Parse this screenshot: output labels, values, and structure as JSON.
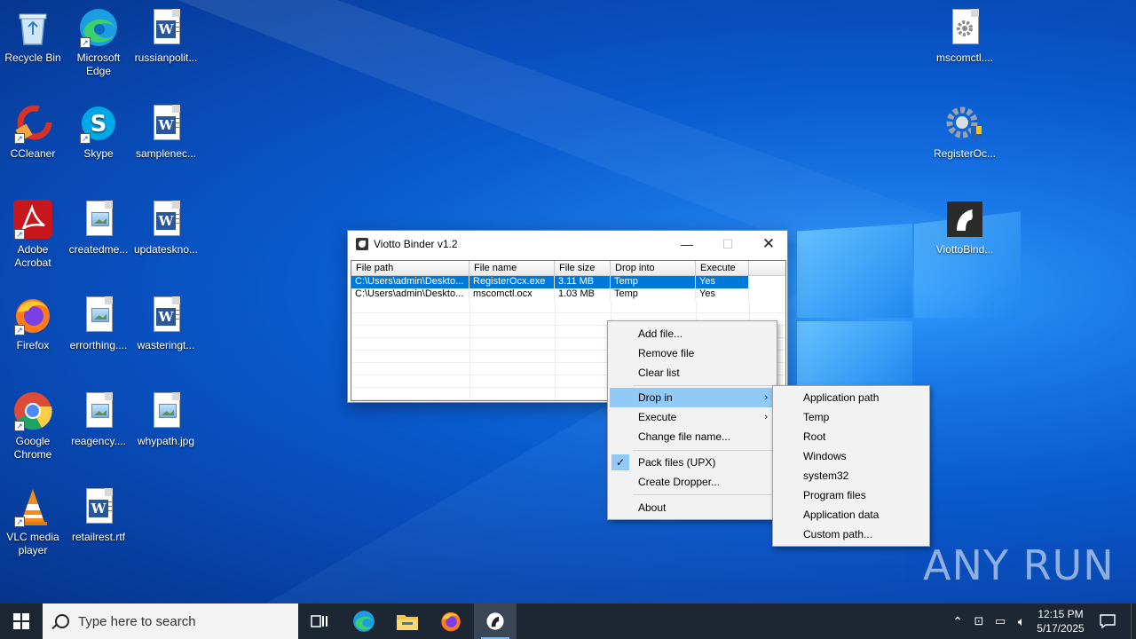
{
  "desktop": {
    "icons_col1": [
      {
        "label": "Recycle Bin"
      },
      {
        "label": "CCleaner"
      },
      {
        "label": "Adobe Acrobat"
      },
      {
        "label": "Firefox"
      },
      {
        "label": "Google Chrome"
      },
      {
        "label": "VLC media player"
      }
    ],
    "icons_col2": [
      {
        "label": "Microsoft Edge"
      },
      {
        "label": "Skype"
      },
      {
        "label": "createdme..."
      },
      {
        "label": "errorthing...."
      },
      {
        "label": "reagency...."
      },
      {
        "label": "retailrest.rtf"
      }
    ],
    "icons_col3": [
      {
        "label": "russianpolit..."
      },
      {
        "label": "samplenec..."
      },
      {
        "label": "updateskno..."
      },
      {
        "label": "wasteringt..."
      },
      {
        "label": "whypath.jpg"
      }
    ],
    "icons_right": [
      {
        "label": "mscomctl...."
      },
      {
        "label": "RegisterOc..."
      },
      {
        "label": "ViottoBind..."
      }
    ],
    "watermark": "ANY RUN"
  },
  "window": {
    "title": "Viotto Binder v1.2",
    "columns": [
      "File path",
      "File name",
      "File size",
      "Drop into",
      "Execute"
    ],
    "rows": [
      {
        "path": "C:\\Users\\admin\\Deskto...",
        "name": "RegisterOcx.exe",
        "size": "3.11 MB",
        "drop": "Temp",
        "exec": "Yes"
      },
      {
        "path": "C:\\Users\\admin\\Deskto...",
        "name": "mscomctl.ocx",
        "size": "1.03 MB",
        "drop": "Temp",
        "exec": "Yes"
      }
    ]
  },
  "context_menu": {
    "items": [
      "Add file...",
      "Remove file",
      "Clear list",
      "Drop in",
      "Execute",
      "Change file name...",
      "Pack files (UPX)",
      "Create Dropper...",
      "About"
    ]
  },
  "submenu": {
    "items": [
      "Application path",
      "Temp",
      "Root",
      "Windows",
      "system32",
      "Program files",
      "Application data",
      "Custom path..."
    ]
  },
  "taskbar": {
    "search_placeholder": "Type here to search",
    "time": "12:15 PM",
    "date": "5/17/2025"
  },
  "colors": {
    "selection": "#0078d7",
    "menu_highlight": "#91c9f7",
    "taskbar": "#1c2733"
  }
}
